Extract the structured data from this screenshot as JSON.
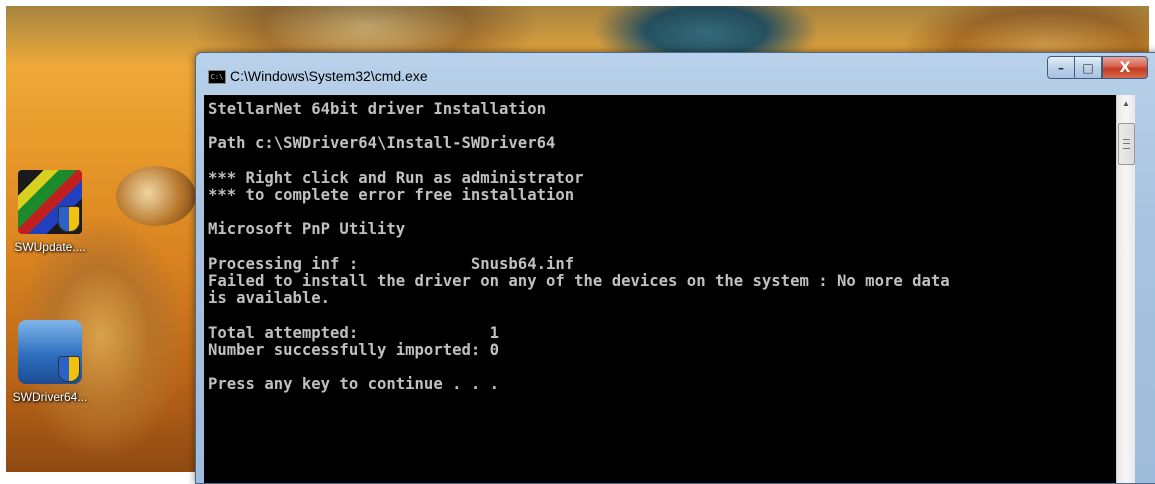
{
  "window": {
    "title": "C:\\Windows\\System32\\cmd.exe",
    "icon": "cmd-icon",
    "icon_text": "C:\\",
    "minimize": "–",
    "maximize": "□",
    "close": "X"
  },
  "console": {
    "lines": [
      "StellarNet 64bit driver Installation",
      "",
      "Path c:\\SWDriver64\\Install-SWDriver64",
      "",
      "*** Right click and Run as administrator",
      "*** to complete error free installation",
      "",
      "Microsoft PnP Utility",
      "",
      "Processing inf :            Snusb64.inf",
      "Failed to install the driver on any of the devices on the system : No more data",
      "is available.",
      "",
      "Total attempted:              1",
      "Number successfully imported: 0",
      "",
      "Press any key to continue . . ."
    ]
  },
  "desktop": {
    "icons": [
      {
        "label": "SWUpdate....",
        "icon": "swupdate-icon"
      },
      {
        "label": "SWDriver64...",
        "icon": "swdriver-installer-icon"
      }
    ]
  },
  "scrollbar": {
    "up_arrow": "▲"
  }
}
